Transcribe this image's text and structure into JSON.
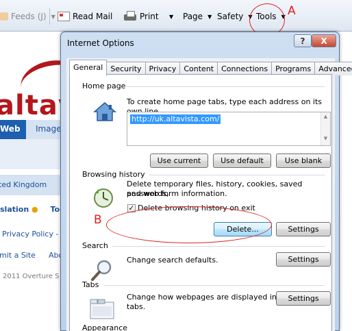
{
  "command_bar": {
    "feeds": "Feeds (J)",
    "read_mail": "Read Mail",
    "print": "Print",
    "page": "Page",
    "safety": "Safety",
    "tools": "Tools"
  },
  "annotations": {
    "a": "A",
    "b": "B",
    "color": "#e01b1b"
  },
  "background_page": {
    "logo": "altavi",
    "tab_web": "Web",
    "tab_images": "Images",
    "country": "ted Kingdom",
    "translation": "slation",
    "too": "Too",
    "privacy": "Privacy Policy -",
    "submit": "mit a Site",
    "about": "Abo",
    "copyright": "2011 Overture S"
  },
  "dialog": {
    "title": "Internet Options",
    "help": "?",
    "close": "X",
    "tabs": [
      {
        "label": "General",
        "active": true
      },
      {
        "label": "Security"
      },
      {
        "label": "Privacy"
      },
      {
        "label": "Content"
      },
      {
        "label": "Connections"
      },
      {
        "label": "Programs"
      },
      {
        "label": "Advanced"
      }
    ],
    "home_page": {
      "heading": "Home page",
      "description": "To create home page tabs, type each address on its own line.",
      "value": "http://uk.altavista.com/",
      "btn_current": "Use current",
      "btn_default": "Use default",
      "btn_blank": "Use blank"
    },
    "browsing_history": {
      "heading": "Browsing history",
      "description_1": "Delete temporary files, history, cookies, saved passwords,",
      "description_2": "and web form information.",
      "checkbox_label": "Delete browsing history on exit",
      "checked": true,
      "btn_delete": "Delete...",
      "btn_settings": "Settings"
    },
    "search": {
      "heading": "Search",
      "description": "Change search defaults.",
      "btn_settings": "Settings"
    },
    "tabs_section": {
      "heading": "Tabs",
      "description_1": "Change how webpages are displayed in",
      "description_2": "tabs.",
      "btn_settings": "Settings"
    },
    "appearance": {
      "heading": "Appearance"
    }
  }
}
